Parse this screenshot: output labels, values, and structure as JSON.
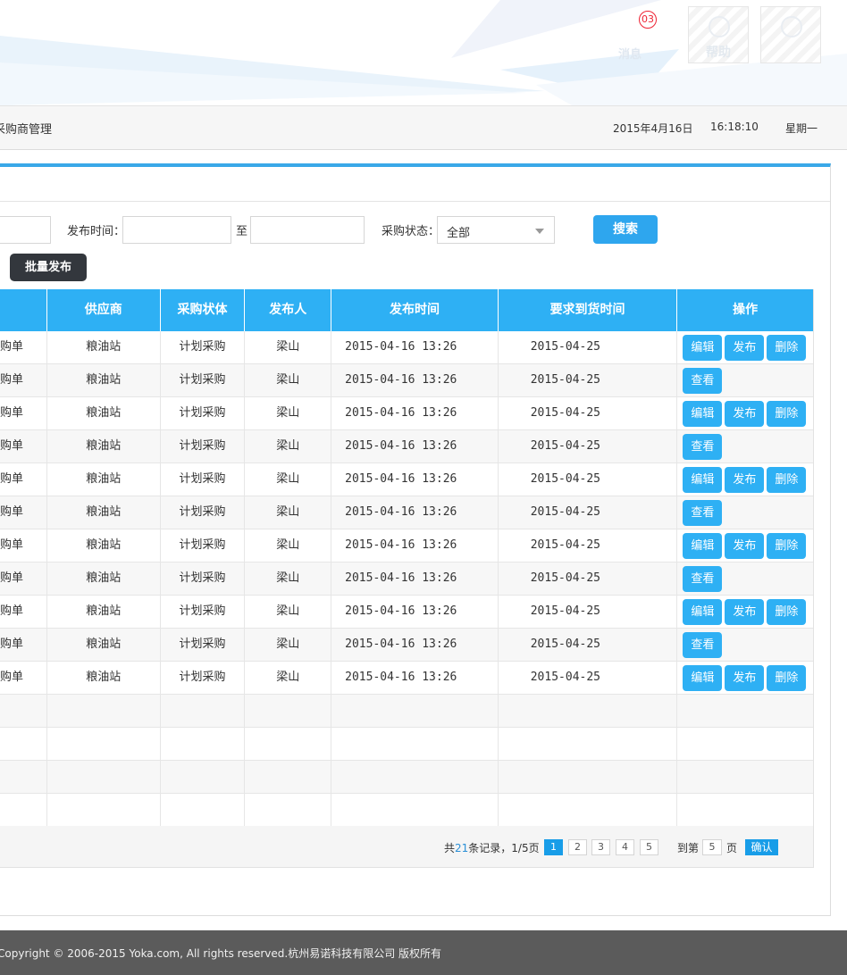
{
  "header": {
    "notice_badge": "03",
    "notice_label": "消息",
    "help_label": "帮助"
  },
  "nav": {
    "breadcrumb": "采购商管理",
    "date": "2015年4月16日",
    "time": "16:18:10",
    "weekday": "星期一"
  },
  "filters": {
    "publish_time_label": "发布时间：",
    "to_label": "至",
    "status_label": "采购状态：",
    "status_value": "全部",
    "search_label": "搜索",
    "batch_label": "批量发布"
  },
  "table": {
    "headers": [
      "",
      "供应商",
      "采购状体",
      "发布人",
      "发布时间",
      "要求到货时间",
      "操作"
    ],
    "rows": [
      {
        "c0": "购单",
        "supplier": "粮油站",
        "status": "计划采购",
        "publisher": "梁山",
        "publish_time": "2015-04-16  13:26",
        "due": "2015-04-25",
        "ops": [
          "编辑",
          "发布",
          "删除"
        ]
      },
      {
        "c0": "购单",
        "supplier": "粮油站",
        "status": "计划采购",
        "publisher": "梁山",
        "publish_time": "2015-04-16  13:26",
        "due": "2015-04-25",
        "ops": [
          "查看"
        ]
      },
      {
        "c0": "购单",
        "supplier": "粮油站",
        "status": "计划采购",
        "publisher": "梁山",
        "publish_time": "2015-04-16  13:26",
        "due": "2015-04-25",
        "ops": [
          "编辑",
          "发布",
          "删除"
        ]
      },
      {
        "c0": "购单",
        "supplier": "粮油站",
        "status": "计划采购",
        "publisher": "梁山",
        "publish_time": "2015-04-16  13:26",
        "due": "2015-04-25",
        "ops": [
          "查看"
        ]
      },
      {
        "c0": "购单",
        "supplier": "粮油站",
        "status": "计划采购",
        "publisher": "梁山",
        "publish_time": "2015-04-16  13:26",
        "due": "2015-04-25",
        "ops": [
          "编辑",
          "发布",
          "删除"
        ]
      },
      {
        "c0": "购单",
        "supplier": "粮油站",
        "status": "计划采购",
        "publisher": "梁山",
        "publish_time": "2015-04-16  13:26",
        "due": "2015-04-25",
        "ops": [
          "查看"
        ]
      },
      {
        "c0": "购单",
        "supplier": "粮油站",
        "status": "计划采购",
        "publisher": "梁山",
        "publish_time": "2015-04-16  13:26",
        "due": "2015-04-25",
        "ops": [
          "编辑",
          "发布",
          "删除"
        ]
      },
      {
        "c0": "购单",
        "supplier": "粮油站",
        "status": "计划采购",
        "publisher": "梁山",
        "publish_time": "2015-04-16  13:26",
        "due": "2015-04-25",
        "ops": [
          "查看"
        ]
      },
      {
        "c0": "购单",
        "supplier": "粮油站",
        "status": "计划采购",
        "publisher": "梁山",
        "publish_time": "2015-04-16  13:26",
        "due": "2015-04-25",
        "ops": [
          "编辑",
          "发布",
          "删除"
        ]
      },
      {
        "c0": "购单",
        "supplier": "粮油站",
        "status": "计划采购",
        "publisher": "梁山",
        "publish_time": "2015-04-16  13:26",
        "due": "2015-04-25",
        "ops": [
          "查看"
        ]
      },
      {
        "c0": "购单",
        "supplier": "粮油站",
        "status": "计划采购",
        "publisher": "梁山",
        "publish_time": "2015-04-16  13:26",
        "due": "2015-04-25",
        "ops": [
          "编辑",
          "发布",
          "删除"
        ]
      }
    ],
    "empty_rows": 4
  },
  "pager": {
    "total_prefix": "共",
    "total_count": "21",
    "total_suffix": "条记录，1/5页",
    "pages": [
      "1",
      "2",
      "3",
      "4",
      "5"
    ],
    "current_page": "1",
    "goto_prefix": "到第",
    "goto_value": "5",
    "goto_suffix": "页",
    "confirm_label": "确认"
  },
  "footer": {
    "copyright": "Copyright © 2006-2015 Yoka.com, All rights reserved.杭州易诺科技有限公司 版权所有"
  },
  "colors": {
    "accent": "#2eb0f4",
    "dark_button": "#33373d",
    "footer": "#5b5b5b"
  }
}
